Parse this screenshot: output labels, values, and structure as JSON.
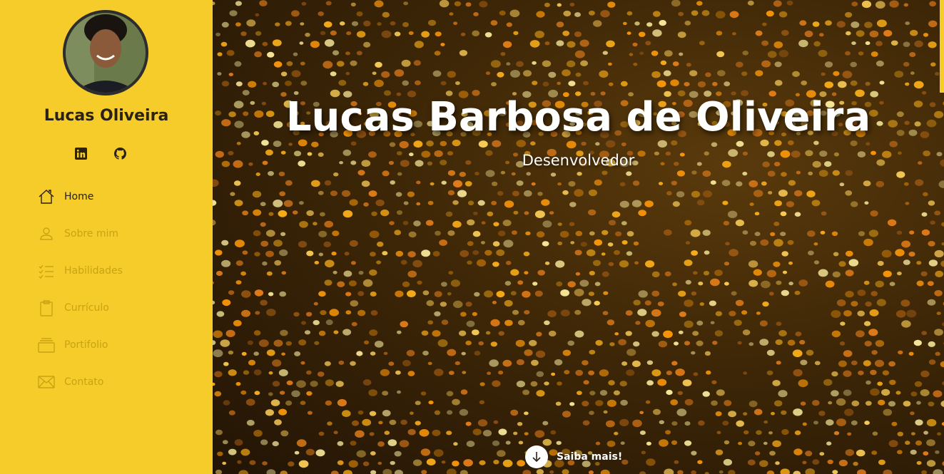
{
  "profile": {
    "name": "Lucas Oliveira",
    "avatar": "profile-photo"
  },
  "social": [
    {
      "icon": "linkedin-icon"
    },
    {
      "icon": "github-icon"
    }
  ],
  "nav": {
    "items": [
      {
        "label": "Home",
        "icon": "home-icon",
        "active": true
      },
      {
        "label": "Sobre mim",
        "icon": "person-icon",
        "active": false
      },
      {
        "label": "Habilidades",
        "icon": "checklist-icon",
        "active": false
      },
      {
        "label": "Currículo",
        "icon": "clipboard-icon",
        "active": false
      },
      {
        "label": "Portifolio",
        "icon": "stack-icon",
        "active": false
      },
      {
        "label": "Contato",
        "icon": "envelope-icon",
        "active": false
      }
    ]
  },
  "hero": {
    "title": "Lucas Barbosa de Oliveira",
    "subtitle": "Desenvolvedor",
    "cta_label": "Saiba mais!",
    "cta_icon": "arrow-down-icon"
  },
  "colors": {
    "sidebar": "#f5cc2a",
    "nav_inactive": "#c9a312",
    "nav_active": "#2a2214"
  }
}
